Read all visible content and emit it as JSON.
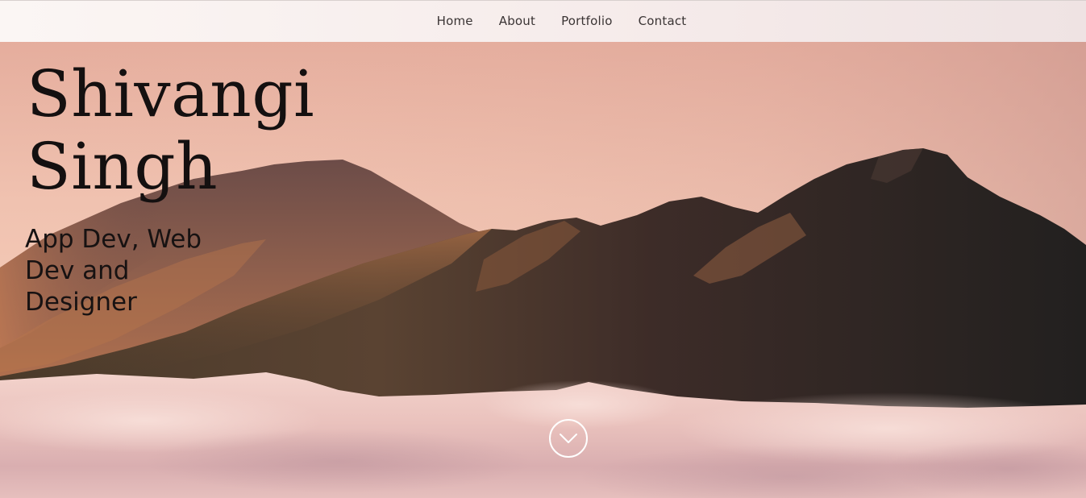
{
  "nav": {
    "items": [
      {
        "label": "Home"
      },
      {
        "label": "About"
      },
      {
        "label": "Portfolio"
      },
      {
        "label": "Contact"
      }
    ]
  },
  "hero": {
    "name_line1": "Shivangi",
    "name_line2": "Singh",
    "subtitle": "App Dev, Web Dev and Designer",
    "scroll_icon": "chevron-down-icon"
  },
  "colors": {
    "sky_top": "#e7b3a3",
    "sky_glow": "#f3c7b5",
    "mountain_dark": "#3b2a27",
    "mountain_light": "#8a5a42",
    "clouds": "#efc9c4",
    "nav_bg": "#f7eeec",
    "text_dark": "#141010",
    "circle_button": "#ffffff"
  }
}
